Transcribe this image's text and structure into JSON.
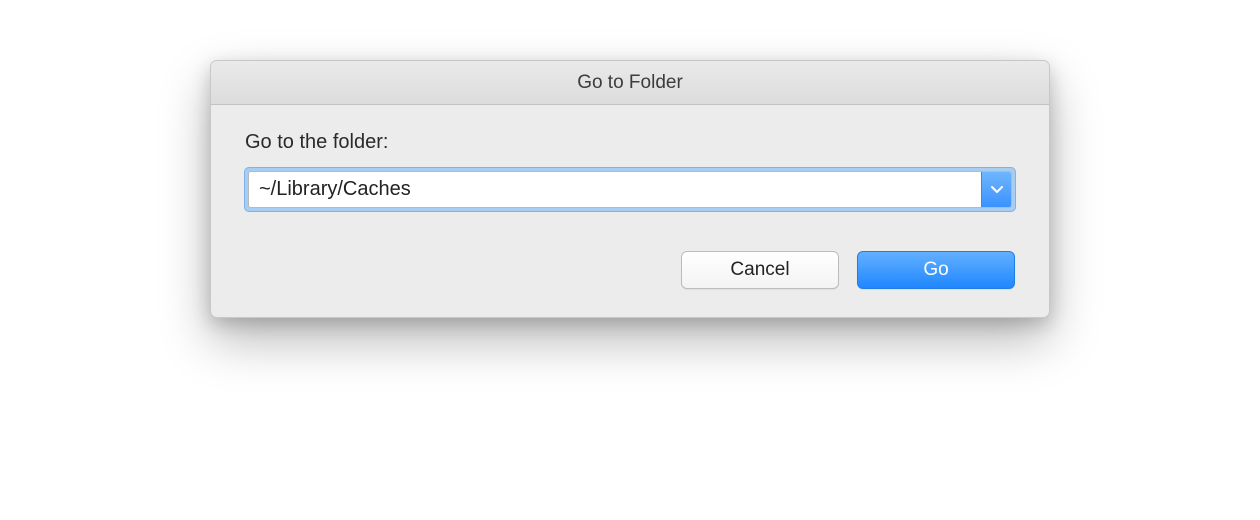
{
  "dialog": {
    "title": "Go to Folder",
    "prompt_label": "Go to the folder:",
    "path_value": "~/Library/Caches",
    "buttons": {
      "cancel": "Cancel",
      "go": "Go"
    }
  }
}
